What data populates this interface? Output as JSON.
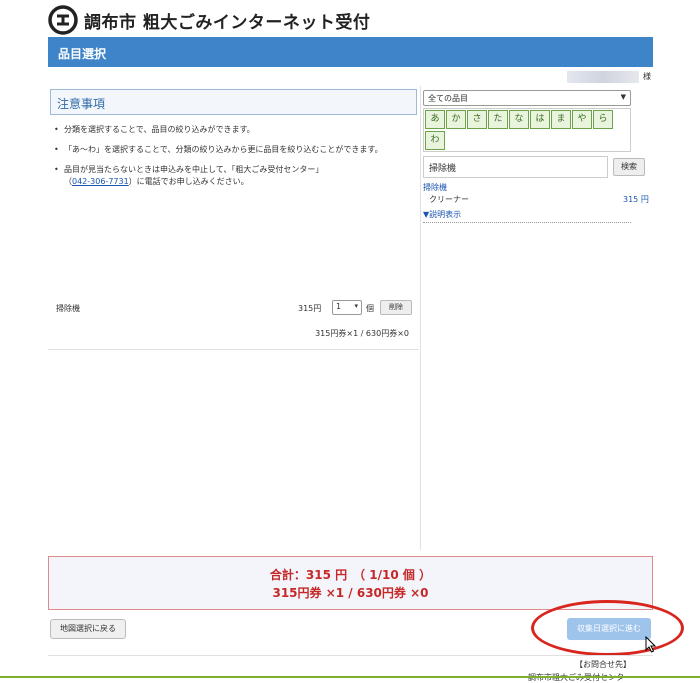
{
  "header": {
    "title": "調布市 粗大ごみインターネット受付",
    "logo_icon": "chofu-city-logo-icon"
  },
  "title_bar": {
    "label": "品目選択"
  },
  "user": {
    "suffix": "様"
  },
  "notice": {
    "heading": "注意事項",
    "items": [
      "分類を選択することで、品目の絞り込みができます。",
      "「あ～わ」を選択することで、分類の絞り込みから更に品目を絞り込むことができます。",
      "品目が見当たらないときは申込みを中止して、「粗大ごみ受付センター」"
    ],
    "phone_prefix": "（",
    "phone": "042-306-7731",
    "phone_suffix": "）に電話でお申し込みください。"
  },
  "cart": {
    "item_name": "掃除機",
    "price": "315円",
    "qty": "1",
    "qty_unit": "個",
    "delete_label": "削除",
    "ticket_line": "315円券×1 / 630円券×0"
  },
  "filter": {
    "category": "全ての品目",
    "kana": [
      "あ",
      "か",
      "さ",
      "た",
      "な",
      "は",
      "ま",
      "や",
      "ら",
      "わ"
    ],
    "search_value": "掃除機",
    "search_label": "検索"
  },
  "results": {
    "category": "掃除機",
    "item": "クリーナー",
    "price": "315 円",
    "detail_link": "▼説明表示"
  },
  "total": {
    "line1": "合計：315 円　（ 1/10 個 ）",
    "line2": "315円券 ×1 / 630円券 ×0"
  },
  "actions": {
    "back_label": "地図選択に戻る",
    "next_label": "収集日選択に進む"
  },
  "footer": {
    "contact_label": "【お問合せ先】",
    "contact_text": "調布市粗大ごみ受付センター"
  },
  "colors": {
    "accent": "#3d85c8",
    "total_text": "#c62828",
    "kana_green": "#6ea24a",
    "annotation_red": "#d8261e"
  }
}
